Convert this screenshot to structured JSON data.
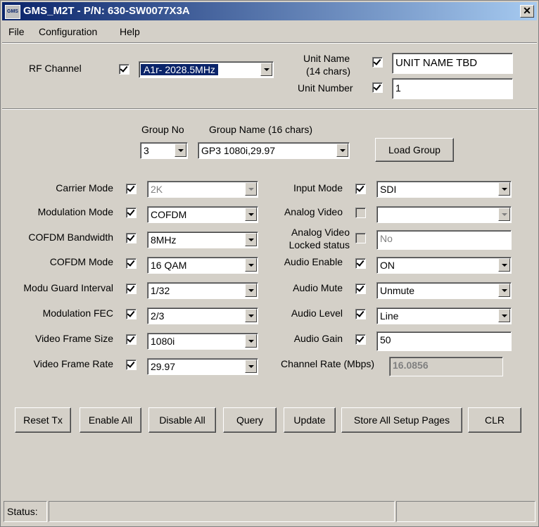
{
  "window": {
    "title": "GMS_M2T - P/N: 630-SW0077X3A",
    "icon_text": "GMS",
    "close_glyph": "✕"
  },
  "menu": {
    "file": "File",
    "configuration": "Configuration",
    "help": "Help"
  },
  "top": {
    "rf_channel_label": "RF Channel",
    "rf_channel_value": "A1r- 2028.5MHz",
    "unit_name_label_1": "Unit Name",
    "unit_name_label_2": "(14 chars)",
    "unit_name_value": "UNIT NAME TBD",
    "unit_number_label": "Unit Number",
    "unit_number_value": "1"
  },
  "group": {
    "group_no_label": "Group No",
    "group_name_label": "Group Name (16 chars)",
    "group_no_value": "3",
    "group_name_value": "GP3 1080i,29.97",
    "load_group_label": "Load Group"
  },
  "left": {
    "carrier_mode_label": "Carrier Mode",
    "carrier_mode_value": "2K",
    "modulation_mode_label": "Modulation Mode",
    "modulation_mode_value": "COFDM",
    "cofdm_bandwidth_label": "COFDM Bandwidth",
    "cofdm_bandwidth_value": "8MHz",
    "cofdm_mode_label": "COFDM Mode",
    "cofdm_mode_value": "16 QAM",
    "guard_interval_label": "Modu Guard Interval",
    "guard_interval_value": "1/32",
    "modulation_fec_label": "Modulation FEC",
    "modulation_fec_value": "2/3",
    "frame_size_label": "Video Frame Size",
    "frame_size_value": "1080i",
    "frame_rate_label": "Video Frame Rate",
    "frame_rate_value": "29.97"
  },
  "right": {
    "input_mode_label": "Input Mode",
    "input_mode_value": "SDI",
    "analog_video_label": "Analog Video",
    "analog_video_value": "",
    "analog_locked_label_1": "Analog Video",
    "analog_locked_label_2": "Locked status",
    "analog_locked_value": "No",
    "audio_enable_label": "Audio Enable",
    "audio_enable_value": "ON",
    "audio_mute_label": "Audio Mute",
    "audio_mute_value": "Unmute",
    "audio_level_label": "Audio Level",
    "audio_level_value": "Line",
    "audio_gain_label": "Audio Gain",
    "audio_gain_value": "50",
    "channel_rate_label": "Channel Rate (Mbps)",
    "channel_rate_value": "16.0856"
  },
  "buttons": {
    "reset_tx": "Reset Tx",
    "enable_all": "Enable All",
    "disable_all": "Disable All",
    "query": "Query",
    "update": "Update",
    "store_all": "Store All Setup Pages",
    "clr": "CLR"
  },
  "status": {
    "label": "Status:",
    "message": "",
    "extra": ""
  },
  "colors": {
    "face": "#d4d0c8",
    "title_start": "#0a246a",
    "title_end": "#a6caf0",
    "selection": "#0a246a"
  }
}
